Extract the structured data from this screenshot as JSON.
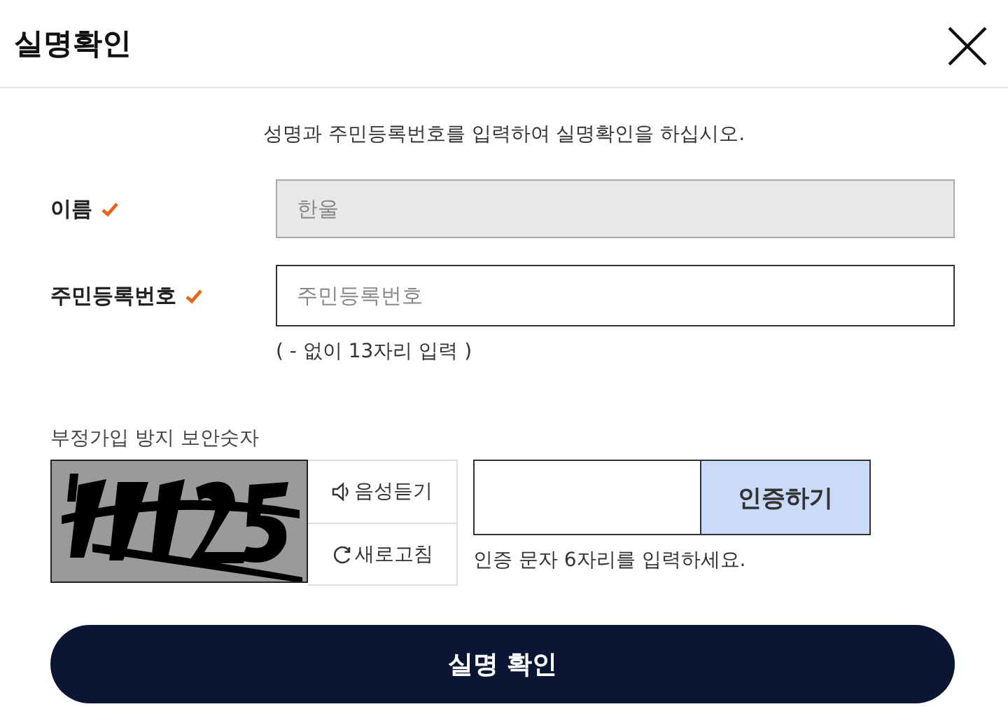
{
  "dialog": {
    "title": "실명확인"
  },
  "instruction": "성명과 주민등록번호를 입력하여 실명확인을 하십시오.",
  "fields": [
    {
      "label": "이름",
      "required": true,
      "value": "한울",
      "disabled": true
    },
    {
      "label": "주민등록번호",
      "required": true,
      "placeholder": "주민등록번호",
      "disabled": false,
      "hint": "( - 없이 13자리 입력 )"
    }
  ],
  "captcha": {
    "label": "부정가입 방지 보안숫자",
    "audio_button": "음성듣기",
    "refresh_button": "새로고침",
    "verify_button": "인증하기",
    "hint": "인증 문자 6자리를 입력하세요."
  },
  "submit_button": "실명 확인"
}
